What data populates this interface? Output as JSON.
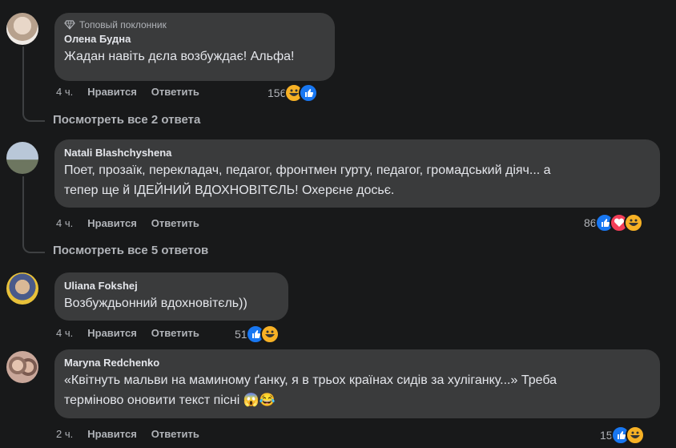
{
  "comments": [
    {
      "badge": "Топовый поклонник",
      "author": "Олена Будна",
      "lines": [
        "Жадан навіть дєла возбуждає! Альфа!"
      ],
      "time": "4 ч.",
      "like_label": "Нравится",
      "reply_label": "Ответить",
      "reaction_count": "156",
      "reactions": [
        "haha-icon",
        "like-icon"
      ],
      "replies_link": "Посмотреть все 2 ответа"
    },
    {
      "author": "Natali Blashchyshena",
      "lines": [
        "Поет, прозаїк, перекладач, педагог, фронтмен гурту, педагог, громадський діяч... а",
        "тепер ще й ІДЕЙНИЙ ВДОХНОВІТЄЛЬ! Охерєне досьє."
      ],
      "time": "4 ч.",
      "like_label": "Нравится",
      "reply_label": "Ответить",
      "reaction_count": "86",
      "reactions": [
        "like-icon",
        "love-icon",
        "haha-icon"
      ],
      "replies_link": "Посмотреть все 5 ответов"
    },
    {
      "author": "Uliana Fokshej",
      "lines": [
        "Возбуждьонний вдохновітєль))"
      ],
      "time": "4 ч.",
      "like_label": "Нравится",
      "reply_label": "Ответить",
      "reaction_count": "51",
      "reactions": [
        "like-icon",
        "haha-icon"
      ]
    },
    {
      "author": "Maryna Redchenko",
      "lines": [
        "«Квітнуть мальви на маминому ґанку, я в трьох країнах сидів за хуліганку...» Треба",
        "терміново оновити текст пісні 😱😂"
      ],
      "time": "2 ч.",
      "like_label": "Нравится",
      "reply_label": "Ответить",
      "reaction_count": "15",
      "reactions": [
        "like-icon",
        "haha-icon"
      ]
    }
  ],
  "colors": {
    "background": "#18191a",
    "bubble": "#3a3b3c",
    "text": "#e4e6eb",
    "secondary": "#b0b3b8",
    "like": "#1877f2",
    "love": "#f33e58",
    "haha": "#f7b125"
  }
}
